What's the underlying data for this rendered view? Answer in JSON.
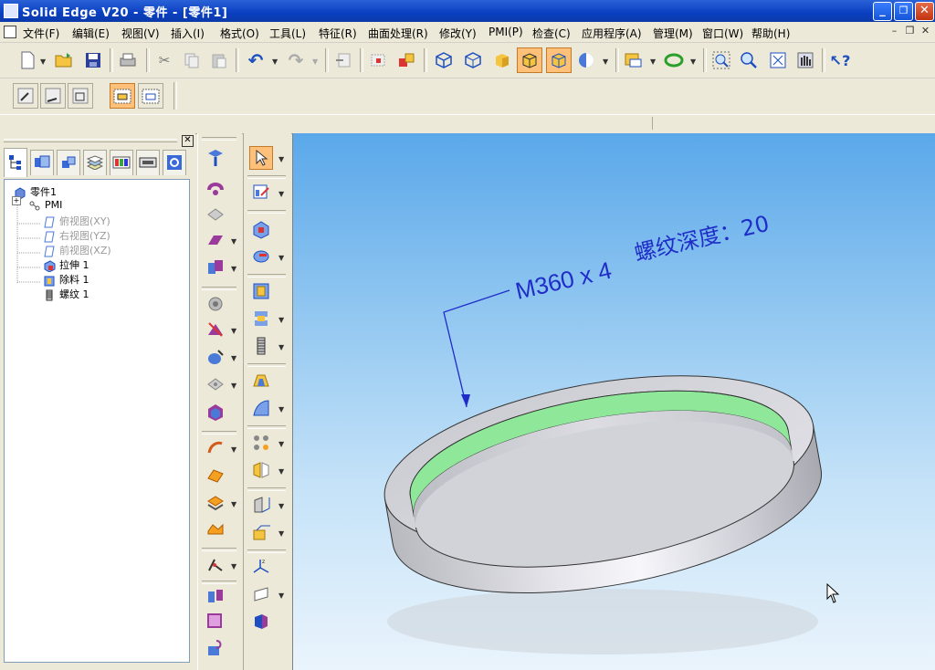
{
  "window": {
    "title": "Solid Edge V20 - 零件 - [零件1]",
    "minimize_glyph": "_",
    "restore_glyph": "❐",
    "close_glyph": "✕"
  },
  "menu": {
    "items": [
      "文件(F)",
      "编辑(E)",
      "视图(V)",
      "插入(I)",
      "格式(O)",
      "工具(L)",
      "特征(R)",
      "曲面处理(R)",
      "修改(Y)",
      "PMI(P)",
      "检查(C)",
      "应用程序(A)",
      "管理(M)",
      "窗口(W)",
      "帮助(H)"
    ],
    "mdi_minimize": "–",
    "mdi_restore": "❐",
    "mdi_close": "✕"
  },
  "toolbar": {
    "icons": [
      "new-icon",
      "open-icon",
      "save-icon",
      "print-icon",
      "cut-icon",
      "copy-icon",
      "paste-icon",
      "undo-icon",
      "redo-icon",
      "paste-special-icon",
      "import-icon",
      "hyperlink-icon",
      "iso-view-icon",
      "dimetric-view-icon",
      "shaded-icon",
      "shaded-visible-edges-icon",
      "shaded-edges-icon",
      "view-style-icon",
      "select-filter-icon",
      "rotate-icon",
      "zoom-area-icon",
      "zoom-icon",
      "fit-icon",
      "pan-icon",
      "whats-this-icon"
    ],
    "active_icons": [
      "shaded-visible-edges-icon",
      "shaded-edges-icon"
    ],
    "accent_color": "#ffc07a"
  },
  "toolbar2": {
    "icons": [
      "sketch-icon",
      "select-plane-icon",
      "profile-icon",
      "view-2d-icon",
      "view-3d-icon"
    ],
    "active_icons": [
      "view-2d-icon"
    ]
  },
  "panel": {
    "close_label": "✕",
    "tabs": [
      "feature-pathfinder-tab",
      "layers-tab",
      "assembly-tab",
      "sensors-tab",
      "color-tab",
      "library-tab",
      "feature-library-tab"
    ],
    "tree": [
      {
        "label": "零件1",
        "level": 0,
        "dim": false,
        "icon": "part-icon"
      },
      {
        "label": "PMI",
        "level": 1,
        "dim": false,
        "icon": "pmi-icon",
        "expander": "+"
      },
      {
        "label": "俯视图(XY)",
        "level": 2,
        "dim": true,
        "icon": "plane-icon"
      },
      {
        "label": "右视图(YZ)",
        "level": 2,
        "dim": true,
        "icon": "plane-icon"
      },
      {
        "label": "前视图(XZ)",
        "level": 2,
        "dim": true,
        "icon": "plane-icon"
      },
      {
        "label": "拉伸 1",
        "level": 2,
        "dim": false,
        "icon": "extrude-icon"
      },
      {
        "label": "除料 1",
        "level": 2,
        "dim": false,
        "icon": "cutout-icon"
      },
      {
        "label": "螺纹 1",
        "level": 2,
        "dim": false,
        "icon": "thread-icon"
      }
    ]
  },
  "viewport": {
    "annotation": {
      "thread_spec": "M360 x 4",
      "depth_label": "螺纹深度：20"
    },
    "annotation_color": "#1f2cc8",
    "thread_face_color": "#88e890",
    "body_color": "#d4d6dc"
  }
}
